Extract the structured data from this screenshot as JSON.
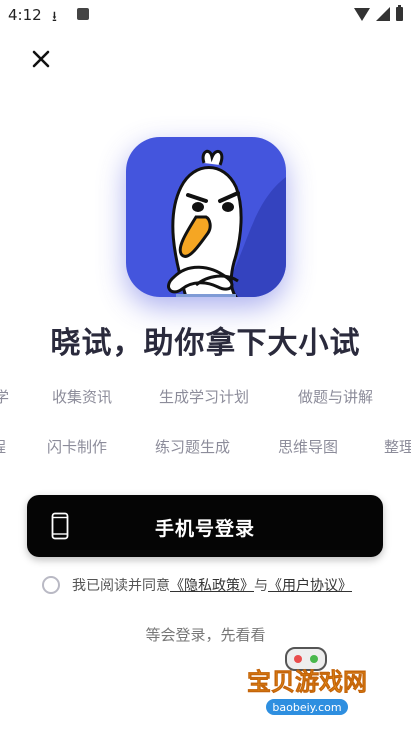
{
  "status_bar": {
    "time": "4:12",
    "icons": [
      "download-icon",
      "app-notification-icon",
      "wifi-icon",
      "signal-icon",
      "battery-icon"
    ]
  },
  "close_icon": "close-icon",
  "logo": {
    "name": "goose-mascot-logo",
    "background": "#3e4fd8"
  },
  "headline": "晓试，助你拿下大小试",
  "features": {
    "row1": [
      "学",
      "收集资讯",
      "生成学习计划",
      "做题与讲解"
    ],
    "row2": [
      "程",
      "闪卡制作",
      "练习题生成",
      "思维导图",
      "整理"
    ]
  },
  "login_button": {
    "label": "手机号登录",
    "icon": "phone-icon"
  },
  "agreement": {
    "prefix": "我已阅读并同意",
    "privacy_link": "《隐私政策》",
    "connector": "与",
    "user_link": "《用户协议》"
  },
  "guest_link": "等会登录，先看看",
  "watermark": {
    "title": "宝贝游戏网",
    "url": "baobeiy.com"
  },
  "colors": {
    "accent": "#3e4fd8",
    "button_bg": "#050505",
    "feature_text": "#8c8c9a"
  }
}
